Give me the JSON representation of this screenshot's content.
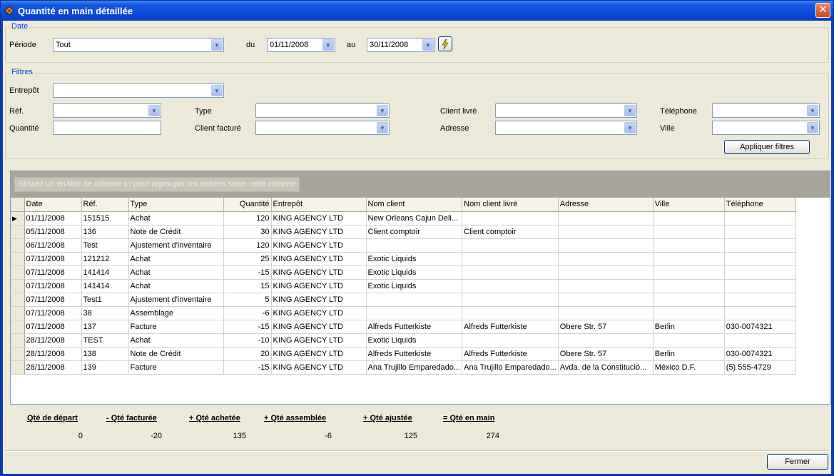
{
  "window": {
    "title": "Quantité en main détaillée",
    "close_glyph": "✕"
  },
  "date_group": {
    "label": "Date",
    "period_label": "Période",
    "period_value": "Tout",
    "from_label": "du",
    "from_value": "01/11/2008",
    "to_label": "au",
    "to_value": "30/11/2008",
    "refresh_icon": "lightning-icon"
  },
  "filters": {
    "label": "Filtres",
    "warehouse_label": "Entrepôt",
    "ref_label": "Réf.",
    "qty_label": "Quantité",
    "type_label": "Type",
    "billed_client_label": "Client facturé",
    "delivered_client_label": "Client livré",
    "address_label": "Adresse",
    "phone_label": "Téléphone",
    "city_label": "Ville",
    "apply_button": "Appliquer filtres"
  },
  "grid": {
    "group_hint": "Glissez un en-tête de colonne ici pour regrouper les entrées selon cette colonne",
    "columns": [
      "Date",
      "Réf.",
      "Type",
      "Quantité",
      "Entrepôt",
      "Nom client",
      "Nom client livré",
      "Adresse",
      "Ville",
      "Téléphone"
    ],
    "rows": [
      [
        "01/11/2008",
        "151515",
        "Achat",
        "120",
        "KING AGENCY LTD",
        "New Orleans Cajun Deli...",
        "",
        "",
        "",
        ""
      ],
      [
        "05/11/2008",
        "136",
        "Note de Crédit",
        "30",
        "KING AGENCY LTD",
        "Client comptoir",
        "Client comptoir",
        "",
        "",
        ""
      ],
      [
        "06/11/2008",
        "Test",
        "Ajustement d'inventaire",
        "120",
        "KING AGENCY LTD",
        "",
        "",
        "",
        "",
        ""
      ],
      [
        "07/11/2008",
        "121212",
        "Achat",
        "25",
        "KING AGENCY LTD",
        "Exotic Liquids",
        "",
        "",
        "",
        ""
      ],
      [
        "07/11/2008",
        "141414",
        "Achat",
        "-15",
        "KING AGENCY LTD",
        "Exotic Liquids",
        "",
        "",
        "",
        ""
      ],
      [
        "07/11/2008",
        "141414",
        "Achat",
        "15",
        "KING AGENCY LTD",
        "Exotic Liquids",
        "",
        "",
        "",
        ""
      ],
      [
        "07/11/2008",
        "Test1",
        "Ajustement d'inventaire",
        "5",
        "KING AGENCY LTD",
        "",
        "",
        "",
        "",
        ""
      ],
      [
        "07/11/2008",
        "38",
        "Assemblage",
        "-6",
        "KING AGENCY LTD",
        "",
        "",
        "",
        "",
        ""
      ],
      [
        "07/11/2008",
        "137",
        "Facture",
        "-15",
        "KING AGENCY LTD",
        "Alfreds Futterkiste",
        "Alfreds Futterkiste",
        "Obere Str. 57",
        "Berlin",
        "030-0074321"
      ],
      [
        "28/11/2008",
        "TEST",
        "Achat",
        "-10",
        "KING AGENCY LTD",
        "Exotic Liquids",
        "",
        "",
        "",
        ""
      ],
      [
        "28/11/2008",
        "138",
        "Note de Crédit",
        "20",
        "KING AGENCY LTD",
        "Alfreds Futterkiste",
        "Alfreds Futterkiste",
        "Obere Str. 57",
        "Berlin",
        "030-0074321"
      ],
      [
        "28/11/2008",
        "139",
        "Facture",
        "-15",
        "KING AGENCY LTD",
        "Ana Trujillo Emparedado...",
        "Ana Trujillo Emparedado...",
        "Avda. de la Constitució...",
        "México D.F.",
        "(5) 555-4729"
      ]
    ]
  },
  "totals": [
    {
      "label": "Qté de départ",
      "value": "0"
    },
    {
      "label": "- Qté facturée",
      "value": "-20"
    },
    {
      "label": "+ Qté achetée",
      "value": "135"
    },
    {
      "label": "+ Qté assemblée",
      "value": "-6"
    },
    {
      "label": "+ Qté ajustée",
      "value": "125"
    },
    {
      "label": "= Qté en main",
      "value": "274"
    }
  ],
  "close_button": "Fermer"
}
